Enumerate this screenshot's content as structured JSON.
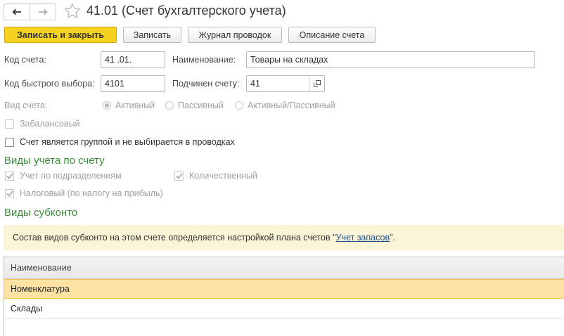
{
  "window": {
    "title": "41.01 (Счет бухгалтерского учета)"
  },
  "toolbar": {
    "save_close": "Записать и закрыть",
    "save": "Записать",
    "journal": "Журнал проводок",
    "description": "Описание счета"
  },
  "form": {
    "code_label": "Код счета:",
    "code_value": "41 .01.",
    "name_label": "Наименование:",
    "name_value": "Товары на складах",
    "quick_code_label": "Код быстрого выбора:",
    "quick_code_value": "4101",
    "parent_label": "Подчинен счету:",
    "parent_value": "41",
    "type_label": "Вид счета:",
    "type_options": [
      "Активный",
      "Пассивный",
      "Активный/Пассивный"
    ],
    "type_selected": "Активный",
    "offbalance_label": "Забалансовый",
    "group_label": "Счет является группой и не выбирается в проводках"
  },
  "accounting_types": {
    "title": "Виды учета по счету",
    "by_division": "Учет по подразделениям",
    "quantitative": "Количественный",
    "tax": "Налоговый (по налогу на прибыль)"
  },
  "subconto": {
    "title": "Виды субконто",
    "info_prefix": "Состав видов субконто на этом счете определяется настройкой плана счетов \"",
    "info_link": "Учет запасов",
    "info_suffix": "\".",
    "column_header": "Наименование",
    "rows": [
      "Номенклатура",
      "Склады"
    ],
    "selected_row": 0
  },
  "colors": {
    "accent": "#f5d21f",
    "section_title": "#3a8c3a",
    "selected_row": "#fbe4a3",
    "info_bg": "#fbf4d6"
  }
}
